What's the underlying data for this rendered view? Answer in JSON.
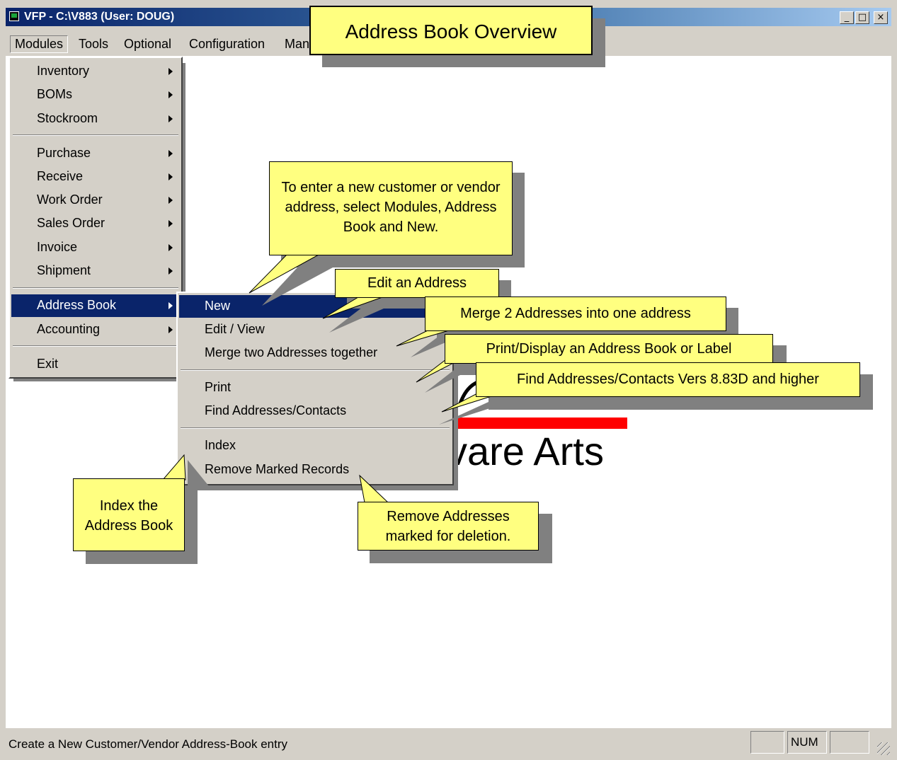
{
  "window": {
    "title": "VFP - C:\\V883  (User: DOUG)",
    "buttons": {
      "minimize": "_",
      "maximize": "□",
      "close": "×"
    }
  },
  "menubar": {
    "items": [
      {
        "label": "Modules"
      },
      {
        "label": "Tools"
      },
      {
        "label": "Optional"
      },
      {
        "label": "Configuration"
      },
      {
        "label": "Man"
      }
    ]
  },
  "modules_menu": {
    "items": [
      {
        "label": "Inventory"
      },
      {
        "label": "BOMs"
      },
      {
        "label": "Stockroom"
      },
      {
        "label": "Purchase"
      },
      {
        "label": "Receive"
      },
      {
        "label": "Work Order"
      },
      {
        "label": "Sales Order"
      },
      {
        "label": "Invoice"
      },
      {
        "label": "Shipment"
      },
      {
        "label": "Address Book"
      },
      {
        "label": "Accounting"
      },
      {
        "label": "Exit"
      }
    ]
  },
  "address_book_menu": {
    "items": [
      {
        "label": "New"
      },
      {
        "label": "Edit / View"
      },
      {
        "label": "Merge two Addresses together"
      },
      {
        "label": "Print"
      },
      {
        "label": "Find Addresses/Contacts"
      },
      {
        "label": "Index"
      },
      {
        "label": "Remove Marked Records"
      }
    ]
  },
  "callouts": {
    "overview": "Address Book Overview",
    "new": "To enter a new customer or vendor address, select Modules, Address Book and New.",
    "edit": "Edit an Address",
    "merge": "Merge 2 Addresses into one address",
    "print": "Print/Display an Address Book or Label",
    "find": "Find Addresses/Contacts Vers 8.83D and higher",
    "index": "Index the Address Book",
    "remove": "Remove Addresses marked for deletion."
  },
  "background_logo": {
    "text": "vare Arts"
  },
  "statusbar": {
    "text": "Create a New Customer/Vendor Address-Book entry",
    "num": "NUM"
  },
  "colors": {
    "callout": "#ffff80",
    "menu_highlight": "#0a246a",
    "logo_bar": "#ff0000"
  }
}
